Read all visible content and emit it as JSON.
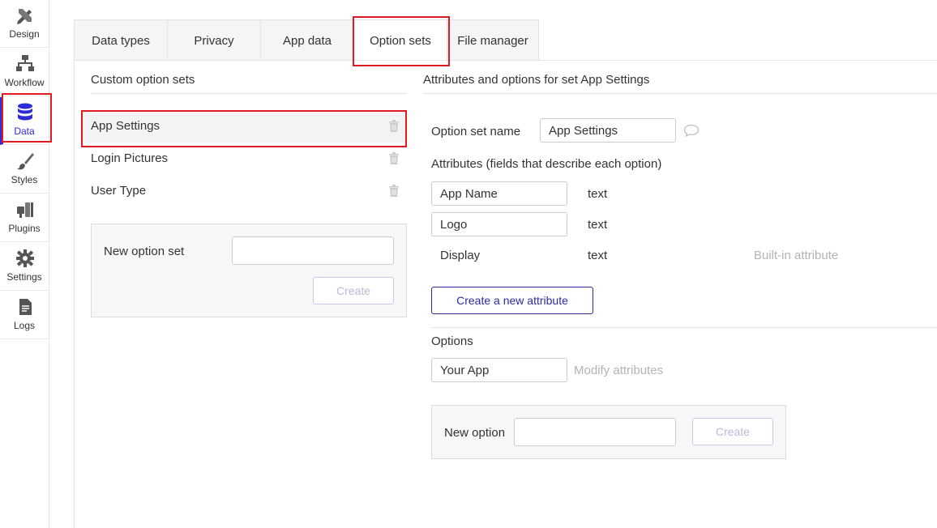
{
  "sidebar": {
    "items": [
      {
        "label": "Design",
        "icon": "design-icon"
      },
      {
        "label": "Workflow",
        "icon": "workflow-icon"
      },
      {
        "label": "Data",
        "icon": "database-icon",
        "active": true
      },
      {
        "label": "Styles",
        "icon": "brush-icon"
      },
      {
        "label": "Plugins",
        "icon": "plug-icon"
      },
      {
        "label": "Settings",
        "icon": "gear-icon"
      },
      {
        "label": "Logs",
        "icon": "document-icon"
      }
    ],
    "active_color": "#2c2cd6"
  },
  "tabs": [
    {
      "label": "Data types"
    },
    {
      "label": "Privacy"
    },
    {
      "label": "App data"
    },
    {
      "label": "Option sets",
      "active": true
    },
    {
      "label": "File manager"
    }
  ],
  "left": {
    "heading": "Custom option sets",
    "sets": [
      {
        "name": "App Settings",
        "selected": true
      },
      {
        "name": "Login Pictures"
      },
      {
        "name": "User Type"
      }
    ],
    "new_set": {
      "label": "New option set",
      "value": "",
      "create_label": "Create"
    }
  },
  "right": {
    "heading": "Attributes and options for set App Settings",
    "set_name_label": "Option set name",
    "set_name_value": "App Settings",
    "attributes_heading": "Attributes (fields that describe each option)",
    "attributes": [
      {
        "name": "App Name",
        "type": "text",
        "editable": true
      },
      {
        "name": "Logo",
        "type": "text",
        "editable": true
      },
      {
        "name": "Display",
        "type": "text",
        "editable": false,
        "note": "Built-in attribute"
      }
    ],
    "create_attribute_label": "Create a new attribute",
    "options_heading": "Options",
    "options": [
      {
        "value": "Your App",
        "action": "Modify attributes"
      }
    ],
    "new_option": {
      "label": "New option",
      "value": "",
      "create_label": "Create"
    }
  },
  "highlight_color": "#e01a22"
}
